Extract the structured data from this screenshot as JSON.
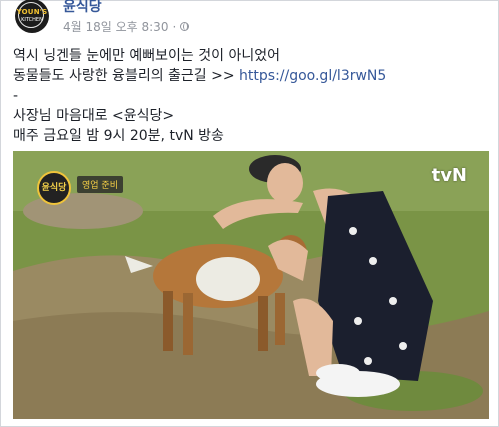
{
  "post": {
    "page_name": "윤식당",
    "timestamp": "4월 18일 오후 8:30",
    "separator": "·",
    "avatar_text_line1": "YOUN'S",
    "avatar_text_line2": "KITCHEN",
    "line1": "역시 닝겐들 눈에만 예뻐보이는 것이 아니었어",
    "line2_text": "동물들도 사랑한 융블리의 출근길 >> ",
    "line2_link": "https://goo.gl/l3rwN5",
    "line3": "-",
    "line4": "사장님 마음대로 <윤식당>",
    "line5": "매주 금요일 밤 9시 20분, tvN 방송"
  },
  "video": {
    "logo_text": "윤식당",
    "badge_text": "영업 준비",
    "channel_text": "tvN"
  },
  "colors": {
    "link": "#365899",
    "meta": "#90949c",
    "text": "#1d2129",
    "border": "#d3d6db"
  },
  "icons": {
    "privacy": "globe-icon"
  }
}
